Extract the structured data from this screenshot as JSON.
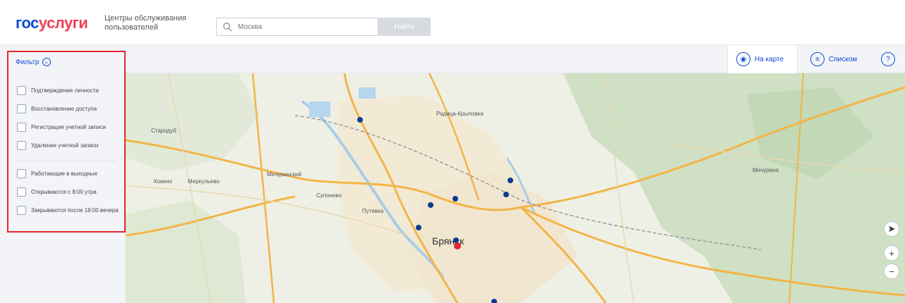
{
  "header": {
    "logo_part1": "гос",
    "logo_part2": "услуги",
    "subtitle": "Центры обслуживания пользователей",
    "search_placeholder": "Москва",
    "search_button": "Найти"
  },
  "toolbar": {
    "map_tab": "На карте",
    "list_tab": "Списком",
    "help": "?"
  },
  "filters": {
    "title": "Фильтр",
    "group1": [
      "Подтверждение личности",
      "Восстановление доступа",
      "Регистрация учетной записи",
      "Удаление учетной записи"
    ],
    "group2": [
      "Работающие в выходные",
      "Открываются с 8:00 утра",
      "Закрываются после 18:00 вечера"
    ]
  },
  "map": {
    "city_label": "Брянск",
    "labels": [
      "Стародуб",
      "Кокино",
      "Мичуринский",
      "Супонево",
      "Путевка",
      "Радица-Крыловка",
      "Мичурина",
      "Меркульево"
    ],
    "marker_color": "#0d3b8c",
    "main_marker_color": "#e4262e"
  },
  "colors": {
    "brand_blue": "#0d4cd3",
    "brand_red": "#ee3f58",
    "highlight": "#e4262e"
  }
}
